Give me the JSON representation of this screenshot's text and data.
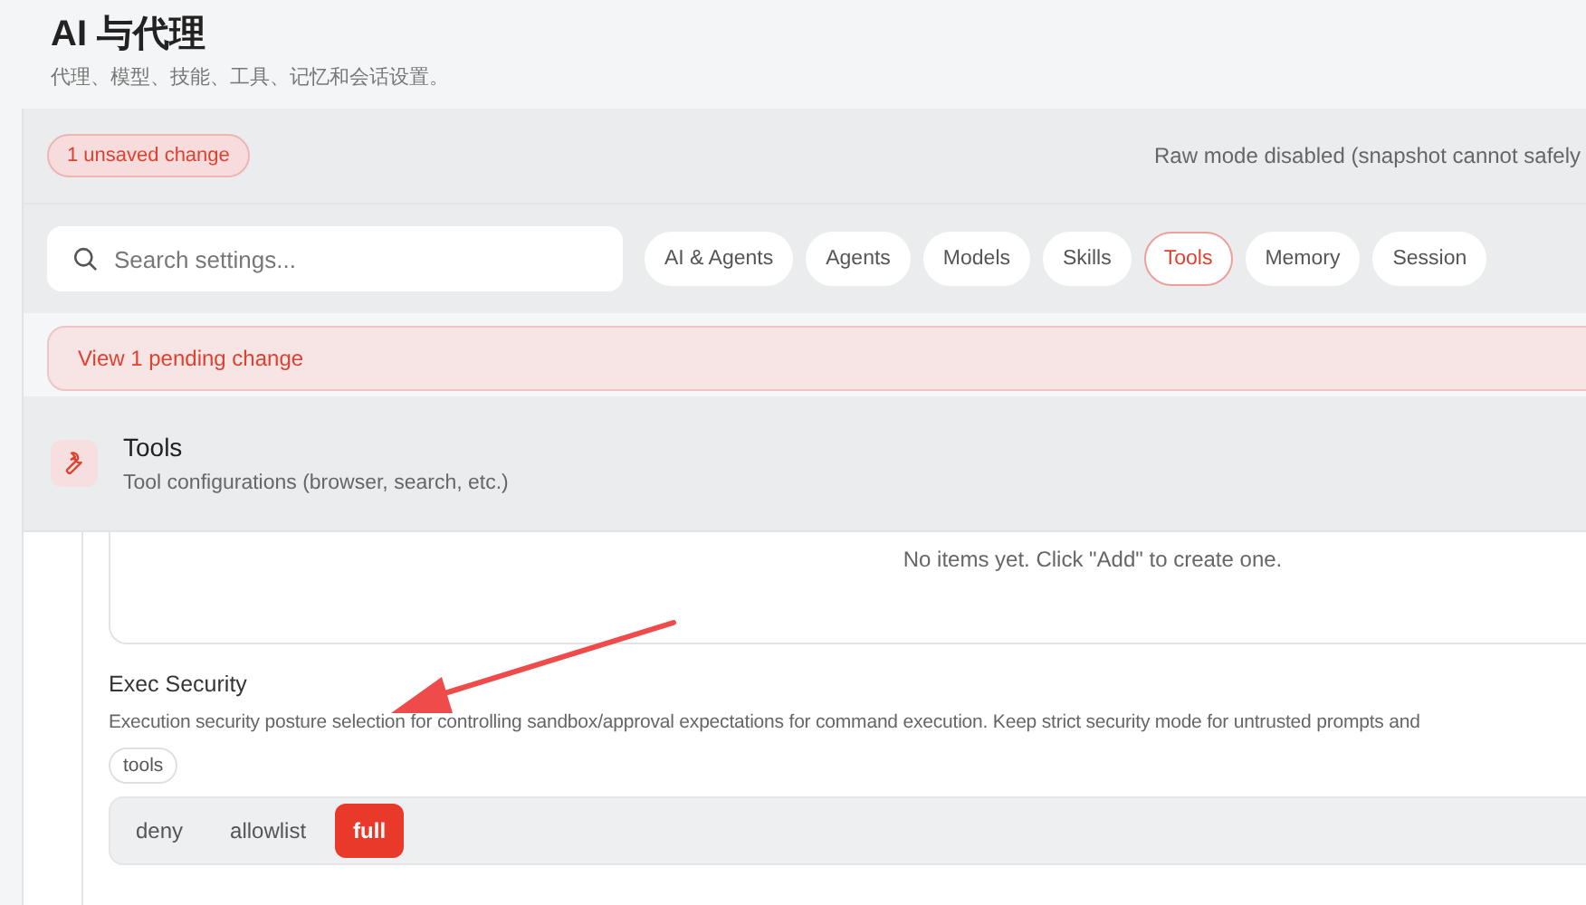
{
  "page": {
    "title": "AI 与代理",
    "subtitle": "代理、模型、技能、工具、记忆和会话设置。"
  },
  "status": {
    "unsaved_badge": "1 unsaved change",
    "raw_mode_note": "Raw mode disabled (snapshot cannot safely"
  },
  "search": {
    "placeholder": "Search settings..."
  },
  "tabs": [
    {
      "label": "AI & Agents",
      "selected": false
    },
    {
      "label": "Agents",
      "selected": false
    },
    {
      "label": "Models",
      "selected": false
    },
    {
      "label": "Skills",
      "selected": false
    },
    {
      "label": "Tools",
      "selected": true
    },
    {
      "label": "Memory",
      "selected": false
    },
    {
      "label": "Session",
      "selected": false
    }
  ],
  "pending_banner": "View 1 pending change",
  "section": {
    "title": "Tools",
    "description": "Tool configurations (browser, search, etc.)"
  },
  "empty_list": {
    "message": "No items yet. Click \"Add\" to create one."
  },
  "field": {
    "label": "Exec Security",
    "description": "Execution security posture selection for controlling sandbox/approval expectations for command execution. Keep strict security mode for untrusted prompts and",
    "tag": "tools",
    "options": [
      {
        "label": "deny",
        "selected": false
      },
      {
        "label": "allowlist",
        "selected": false
      },
      {
        "label": "full",
        "selected": true
      }
    ]
  }
}
